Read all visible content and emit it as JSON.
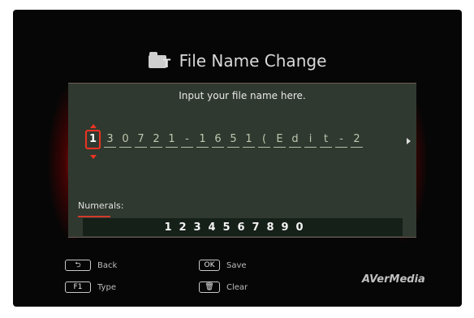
{
  "header": {
    "title": "File Name Change",
    "icon": "folder-rename-icon"
  },
  "panel": {
    "prompt": "Input your file name here.",
    "characters": [
      "1",
      "3",
      "0",
      "7",
      "2",
      "1",
      "-",
      "1",
      "6",
      "5",
      "1",
      "(",
      "E",
      "d",
      "i",
      "t",
      "-",
      "2"
    ],
    "selected_index": 0
  },
  "keyboard": {
    "mode_label": "Numerals:",
    "keys": [
      "1",
      "2",
      "3",
      "4",
      "5",
      "6",
      "7",
      "8",
      "9",
      "0"
    ]
  },
  "legend": {
    "back": {
      "key": "⮌",
      "label": "Back"
    },
    "type": {
      "key": "F1",
      "label": "Type"
    },
    "save": {
      "key": "OK",
      "label": "Save"
    },
    "clear": {
      "key": "🗑",
      "label": "Clear"
    }
  },
  "brand": "AVerMedia"
}
